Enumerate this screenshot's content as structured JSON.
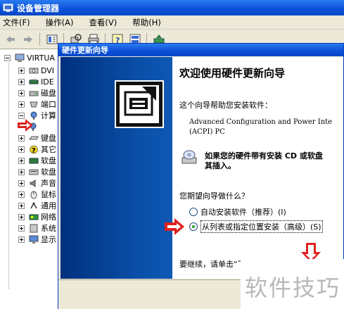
{
  "window": {
    "title": "设备管理器"
  },
  "menu": [
    {
      "label": "文件(F)"
    },
    {
      "label": "操作(A)"
    },
    {
      "label": "查看(V)"
    },
    {
      "label": "帮助(H)"
    }
  ],
  "tree": {
    "root": "VIRTUA",
    "items": [
      {
        "label": "DVI",
        "icon": "dvd-drive-icon"
      },
      {
        "label": "IDE",
        "icon": "ide-controller-icon"
      },
      {
        "label": "磁盘",
        "icon": "disk-drive-icon"
      },
      {
        "label": "端口",
        "icon": "port-icon"
      },
      {
        "label": "计算",
        "icon": "computer-icon"
      },
      {
        "label": "",
        "icon": "acpi-device-icon"
      },
      {
        "label": "键盘",
        "icon": "keyboard-icon"
      },
      {
        "label": "其它",
        "icon": "unknown-device-icon"
      },
      {
        "label": "软盘",
        "icon": "floppy-controller-icon"
      },
      {
        "label": "软盘",
        "icon": "floppy-drive-icon"
      },
      {
        "label": "声音",
        "icon": "sound-icon"
      },
      {
        "label": "鼠标",
        "icon": "mouse-icon"
      },
      {
        "label": "通用",
        "icon": "usb-icon"
      },
      {
        "label": "网络",
        "icon": "network-icon"
      },
      {
        "label": "系统",
        "icon": "system-icon"
      },
      {
        "label": "显示",
        "icon": "display-icon"
      }
    ]
  },
  "wizard": {
    "title": "硬件更新向导",
    "heading": "欢迎使用硬件更新向导",
    "intro": "这个向导帮助您安装软件：",
    "device_line1": "Advanced Configuration and Power Inte",
    "device_line2": "(ACPI) PC",
    "cd_line1": "如果您的硬件带有安装 CD 或软盘",
    "cd_line2": "其插入。",
    "question": "您期望向导做什么？",
    "options": [
      {
        "label": "自动安装软件（推荐）(I)",
        "selected": false
      },
      {
        "label": "从列表或指定位置安装（高级）(S)",
        "selected": true
      }
    ],
    "continue_text": "要继续，请单击“下一步”。"
  },
  "watermark": {
    "text": "软件技巧"
  },
  "colors": {
    "titlebar": "#0a4fd6",
    "annotation_arrow": "#e02020",
    "wizard_banner": "#0a4fa8"
  }
}
